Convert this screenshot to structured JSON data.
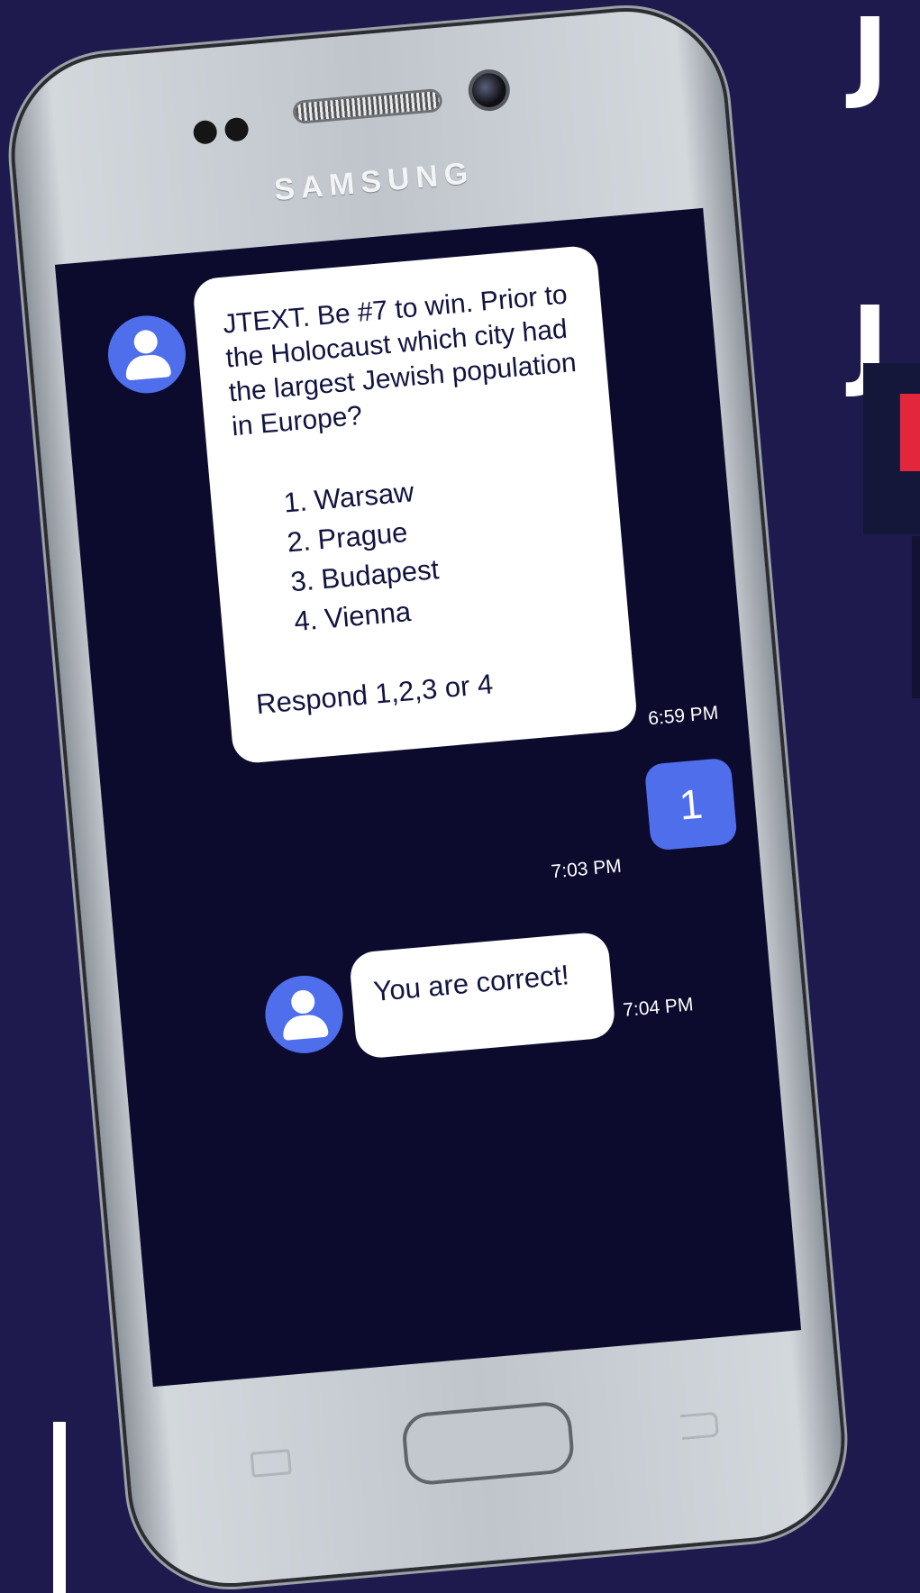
{
  "background": {
    "letters": [
      "J",
      "J"
    ],
    "red_letter": "F",
    "colors": {
      "background": "#1e1a4d",
      "accent_red": "#e3263b"
    }
  },
  "phone": {
    "brand": "SAMSUNG",
    "colors": {
      "screen": "#0c0b2e",
      "accent": "#4f6eec",
      "bubble": "#ffffff"
    }
  },
  "chat": {
    "messages": [
      {
        "sender": "incoming",
        "avatar_icon": "user-icon",
        "text": "JTEXT. Be #7 to win. Prior to the Holocaust which city had the largest Jewish population in Europe?",
        "options": [
          {
            "num": "1.",
            "label": "Warsaw"
          },
          {
            "num": "2.",
            "label": "Prague"
          },
          {
            "num": "3.",
            "label": "Budapest"
          },
          {
            "num": "4.",
            "label": "Vienna"
          }
        ],
        "footer": "Respond 1,2,3 or 4",
        "time": "6:59 PM"
      },
      {
        "sender": "outgoing",
        "text": "1",
        "time": "7:03 PM"
      },
      {
        "sender": "incoming",
        "avatar_icon": "user-icon",
        "text": "You are correct!",
        "time": "7:04 PM"
      }
    ]
  }
}
